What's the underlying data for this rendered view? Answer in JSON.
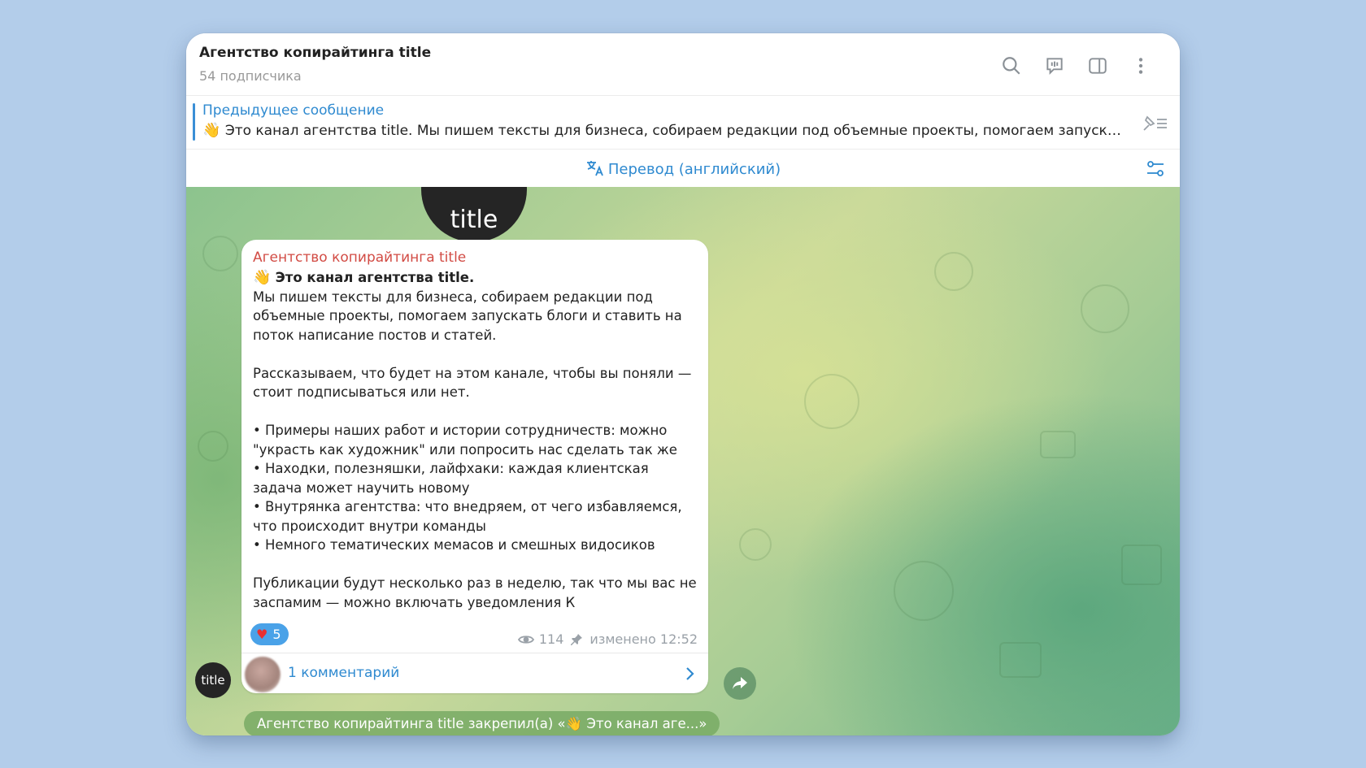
{
  "header": {
    "title": "Агентство копирайтинга title",
    "subtitle": "54 подписчика",
    "icons": [
      "search-icon",
      "discussion-icon",
      "sidebar-toggle-icon",
      "more-vertical-icon"
    ]
  },
  "pinned": {
    "heading": "Предыдущее сообщение",
    "text": "Это канал агентства title. Мы пишем тексты для бизнеса, собираем редакции под объемные проекты, помогаем запускать блоги и ставить на поток написание постов и статей."
  },
  "translate": {
    "label": "Перевод (английский)"
  },
  "channel_avatar_text": "title",
  "message": {
    "author": "Агентство копирайтинга title",
    "headline": "Это канал агентства title.",
    "p1": "Мы пишем тексты для бизнеса, собираем редакции под объемные проекты, помогаем запускать блоги и ставить на поток написание постов и статей.",
    "p2": "Рассказываем, что будет на этом канале, чтобы вы поняли — стоит подписываться или нет.",
    "bullets": [
      "• Примеры наших работ и истории сотрудничеств: можно \"украсть как художник\" или попросить нас сделать так же",
      "• Находки, полезняшки, лайфхаки: каждая клиентская задача может научить новому",
      "• Внутрянка агентства: что внедряем, от чего избавляемся, что происходит внутри команды",
      "• Немного тематических мемасов и смешных видосиков"
    ],
    "p3": "Публикации будут несколько раз в неделю, так что мы вас не заспамим — можно включать уведомления",
    "p3_tail": "К",
    "reaction_count": "5",
    "views": "114",
    "edited": "изменено 12:52"
  },
  "comments": {
    "label": "1 комментарий"
  },
  "service": {
    "text": "Агентство копирайтинга title закрепил(а) «👋 Это канал аге...»"
  },
  "colors": {
    "accent": "#2f8ad0",
    "author": "#d24b44",
    "reaction": "#4aa2e8"
  }
}
